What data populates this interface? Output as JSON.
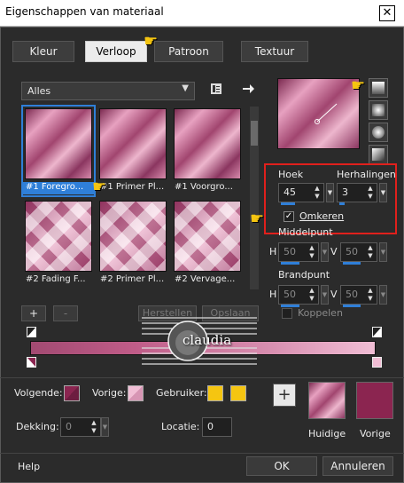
{
  "window": {
    "title": "Eigenschappen van materiaal",
    "close": "✕"
  },
  "tabs": [
    {
      "label": "Kleur"
    },
    {
      "label": "Verloop"
    },
    {
      "label": "Patroon"
    },
    {
      "label": "Textuur"
    }
  ],
  "category": {
    "value": "Alles"
  },
  "thumbnails": [
    {
      "caption": "#1 Foregro..."
    },
    {
      "caption": "#1 Primer Pl..."
    },
    {
      "caption": "#1 Voorgro..."
    },
    {
      "caption": "#2 Fading F..."
    },
    {
      "caption": "#2 Primer Pl..."
    },
    {
      "caption": "#2 Vervage..."
    }
  ],
  "params": {
    "angle_label": "Hoek",
    "angle_value": "45",
    "repeats_label": "Herhalingen",
    "repeats_value": "3",
    "invert_label": "Omkeren",
    "invert_checked": true,
    "center_label": "Middelpunt",
    "center_h_label": "H",
    "center_h_value": "50",
    "center_v_label": "V",
    "center_v_value": "50",
    "focal_label": "Brandpunt",
    "focal_h_label": "H",
    "focal_h_value": "50",
    "focal_v_label": "V",
    "focal_v_value": "50",
    "link_label": "Koppelen"
  },
  "editor": {
    "add": "+",
    "remove": "-",
    "reset": "Herstellen",
    "save": "Opslaan"
  },
  "markers": {
    "prev_label": "Volgende:",
    "back_label": "Vorige:",
    "user_label": "Gebruiker:",
    "opacity_label": "Dekking:",
    "opacity_value": "0",
    "location_label": "Locatie:",
    "location_value": "0",
    "add_swatch": "+"
  },
  "current": {
    "label": "Huidige"
  },
  "previous": {
    "label": "Vorige"
  },
  "footer": {
    "help": "Help",
    "ok": "OK",
    "cancel": "Annuleren"
  },
  "watermark": {
    "text": "claudia"
  },
  "colors": {
    "accent_blue": "#2f7fd8",
    "highlight_red": "#e0201c",
    "dark_rose": "#8b2550",
    "light_pink": "#f1bed5",
    "yellow": "#f5c511"
  }
}
